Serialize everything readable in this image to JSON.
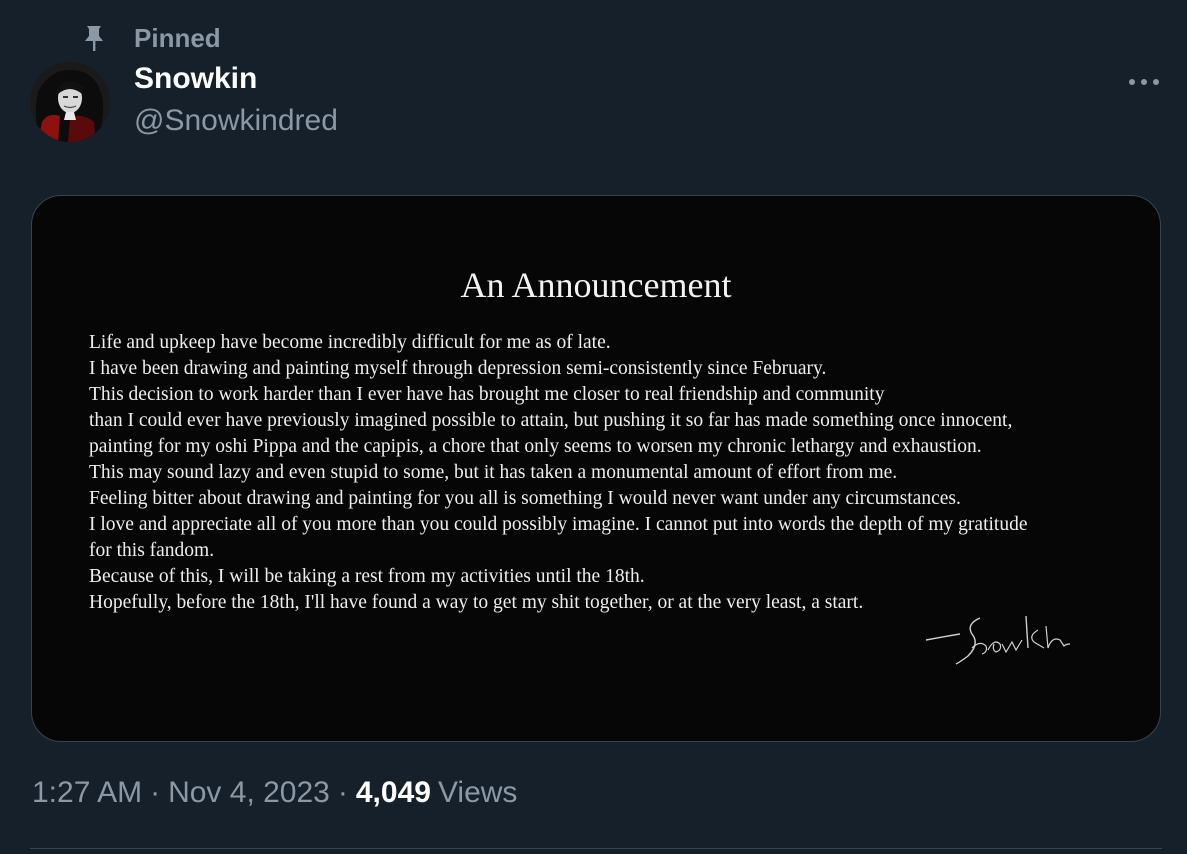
{
  "social_context": {
    "pinned_label": "Pinned"
  },
  "author": {
    "display_name": "Snowkin",
    "handle": "@Snowkindred"
  },
  "media": {
    "title": "An Announcement",
    "lines": [
      "Life and upkeep have become incredibly difficult for me as of late.",
      "I have been drawing and painting myself through depression semi-consistently since February.",
      "This decision to work harder than I ever have has brought me closer to real friendship and community",
      "than I could ever have previously imagined possible to attain, but pushing it so far has made something once innocent,",
      "painting for my oshi Pippa and the capipis, a chore that only seems to worsen my chronic lethargy and exhaustion.",
      "This may sound lazy and even stupid to some, but it has taken a monumental amount of effort from me.",
      "Feeling bitter about drawing and painting for you all is something I would never want under any circumstances.",
      "I love and appreciate all of you more than you could possibly imagine. I cannot put into words the depth of my gratitude",
      "for this fandom.",
      "Because of this, I will be taking a rest from my activities until the 18th.",
      "Hopefully, before the 18th, I'll have found a way to get my shit together, or at the very least, a start."
    ],
    "signature": "Snowkin"
  },
  "meta": {
    "time": "1:27 AM",
    "separator": "·",
    "date": "Nov 4, 2023",
    "views_count": "4,049",
    "views_label": "Views"
  },
  "icons": {
    "pin": "pin-icon",
    "more": "more-icon"
  },
  "colors": {
    "background": "#15202b",
    "secondary_text": "#8b98a5",
    "border": "#38444d",
    "media_background": "#060606"
  }
}
